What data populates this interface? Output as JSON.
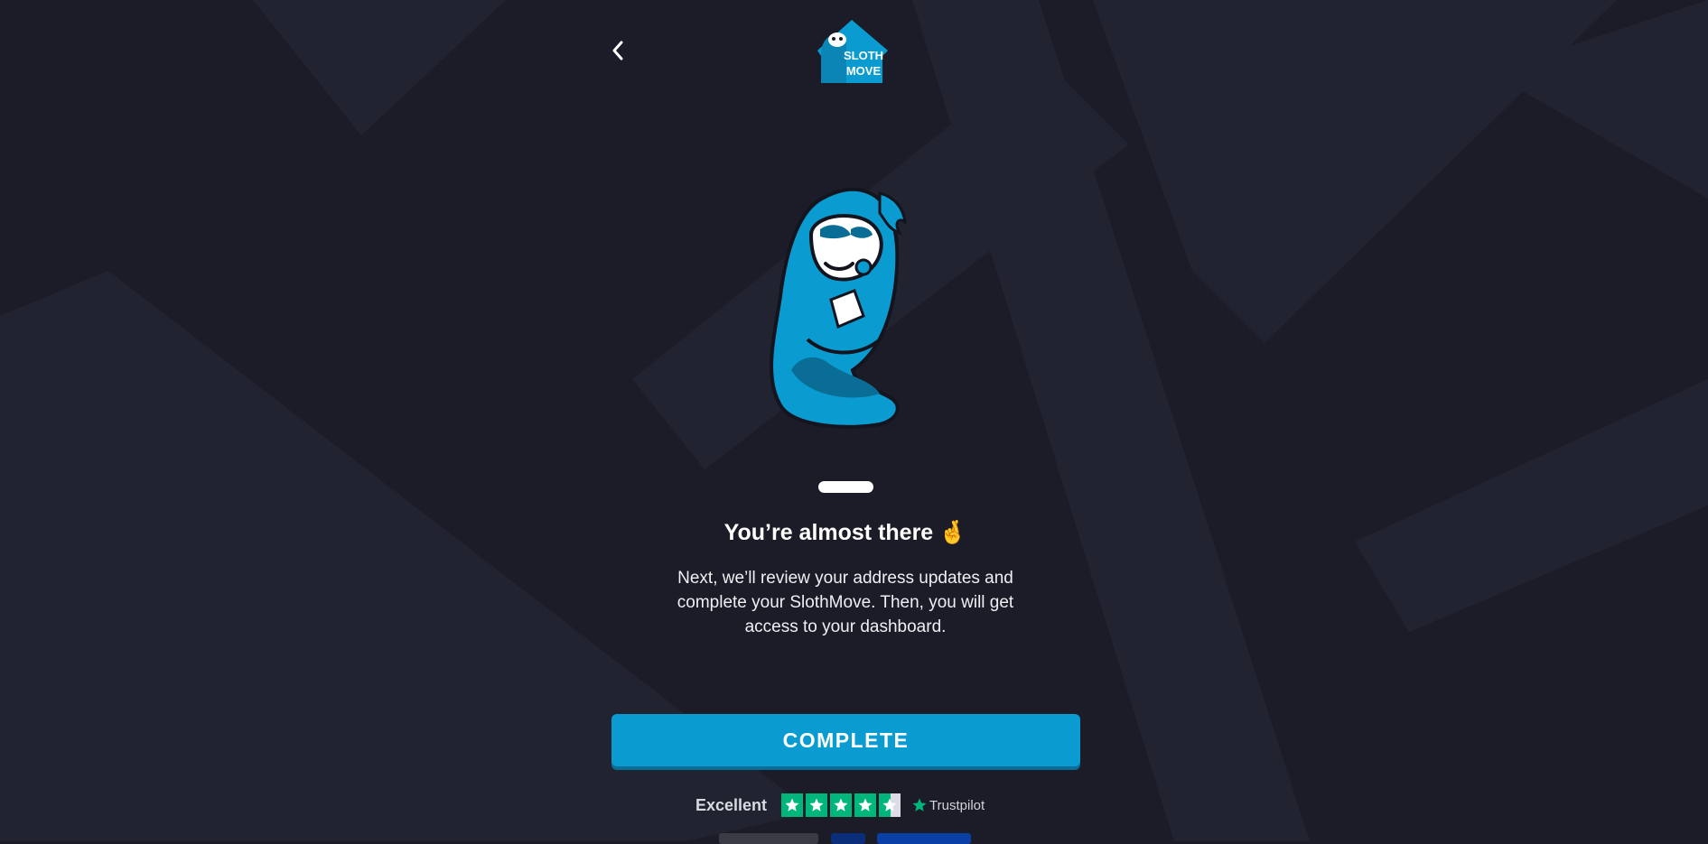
{
  "brand": {
    "name": "SlothMove",
    "logo_word_1": "SLOTH",
    "logo_word_2": "MOVE"
  },
  "header": {
    "back_icon": "chevron-left-icon"
  },
  "progress": {
    "step_current": 1,
    "step_total": 1
  },
  "content": {
    "title": "You’re almost there",
    "title_emoji": "🤞",
    "description": "Next, we’ll review your address updates and complete your SlothMove. Then, you will get access to your dashboard."
  },
  "actions": {
    "complete_label": "COMPLETE"
  },
  "trustpilot": {
    "rating_word": "Excellent",
    "brand": "Trustpilot",
    "stars": 4.5
  },
  "colors": {
    "background": "#1b1c27",
    "accent": "#0a9bd1",
    "trustpilot_green": "#00b67a"
  }
}
